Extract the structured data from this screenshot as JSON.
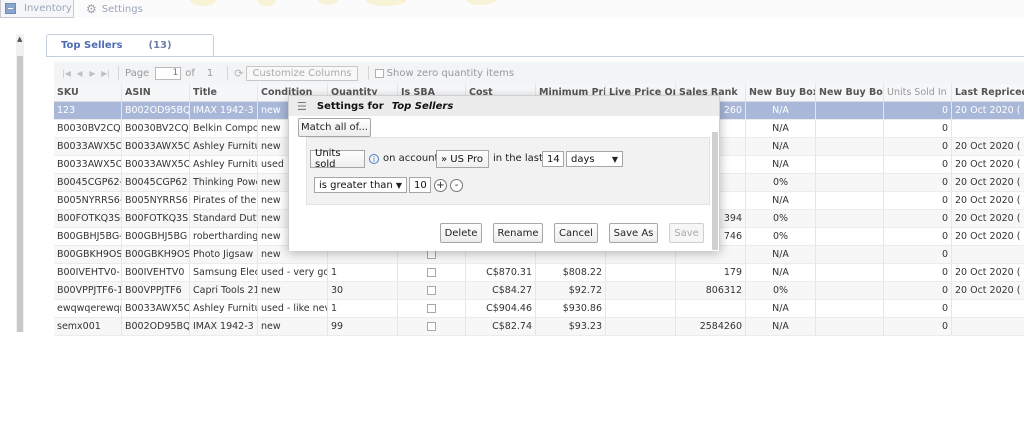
{
  "nav": {
    "inventory": "Inventory",
    "settings": "Settings"
  },
  "tab": {
    "label": "Top Sellers",
    "count": "(13)"
  },
  "pager": {
    "page_label": "Page",
    "page_value": "1",
    "of_label": "of",
    "total_pages": "1",
    "customize_label": "Customize Columns",
    "zero_qty_label": "Show zero quantity items"
  },
  "columns": [
    "SKU",
    "ASIN",
    "Title",
    "Condition",
    "Quantity",
    "Is SBA",
    "Cost",
    "Minimum Pri",
    "Live Price Or",
    "Sales Rank",
    "New Buy Box",
    "New Buy Box",
    "Units Sold In",
    "Last Repriced"
  ],
  "rows": [
    [
      "123",
      "B002OD95BQ",
      "IMAX 1942-3",
      "new",
      "",
      "",
      "",
      "",
      "",
      "260",
      "N/A",
      "",
      "0",
      "20 Oct 2020 ("
    ],
    [
      "B0030BV2CQ-",
      "B0030BV2CQ",
      "Belkin Compo",
      "new",
      "",
      "",
      "",
      "",
      "",
      "",
      "N/A",
      "",
      "0",
      ""
    ],
    [
      "B0033AWX5O",
      "B0033AWX5O",
      "Ashley Furnitu",
      "new",
      "",
      "",
      "",
      "",
      "",
      "",
      "N/A",
      "",
      "0",
      "20 Oct 2020 ("
    ],
    [
      "B0033AWX5O",
      "B0033AWX5O",
      "Ashley Furnitu",
      "used",
      "",
      "",
      "",
      "",
      "",
      "",
      "N/A",
      "",
      "0",
      "20 Oct 2020 ("
    ],
    [
      "B0045CGP62-",
      "B0045CGP62",
      "Thinking Powe",
      "new",
      "",
      "",
      "",
      "",
      "",
      "",
      "0%",
      "",
      "0",
      "20 Oct 2020 ("
    ],
    [
      "B005NYRRS6-",
      "B005NYRRS6",
      "Pirates of the",
      "new",
      "",
      "",
      "",
      "",
      "",
      "",
      "N/A",
      "",
      "0",
      "20 Oct 2020 ("
    ],
    [
      "B00FOTKQ3S-",
      "B00FOTKQ3S",
      "Standard Duty",
      "new",
      "",
      "",
      "",
      "",
      "",
      "394",
      "0%",
      "",
      "0",
      "20 Oct 2020 ("
    ],
    [
      "B00GBHJ5BG-",
      "B00GBHJ5BG",
      "robertharding",
      "new",
      "",
      "",
      "",
      "",
      "",
      "746",
      "0%",
      "",
      "0",
      "20 Oct 2020 ("
    ],
    [
      "B00GBKH9OS",
      "B00GBKH9OS",
      "Photo Jigsaw F",
      "new",
      "",
      "",
      "",
      "",
      "",
      "",
      "N/A",
      "",
      "0",
      ""
    ],
    [
      "B00IVEHTV0-",
      "B00IVEHTV0",
      "Samsung Elec",
      "used - very go",
      "1",
      "",
      "C$870.31",
      "$808.22",
      "",
      "179",
      "N/A",
      "",
      "0",
      "20 Oct 2020 ("
    ],
    [
      "B00VPPJTF6-1",
      "B00VPPJTF6",
      "Capri Tools 21",
      "new",
      "30",
      "",
      "C$84.27",
      "$92.72",
      "",
      "806312",
      "0%",
      "",
      "0",
      "20 Oct 2020 ("
    ],
    [
      "ewqwqerewqr",
      "B0033AWX5O",
      "Ashley Furnitu",
      "used - like nev",
      "1",
      "",
      "C$904.46",
      "$930.86",
      "",
      "",
      "N/A",
      "",
      "0",
      ""
    ],
    [
      "semx001",
      "B002OD95BQ",
      "IMAX 1942-3",
      "new",
      "99",
      "",
      "C$82.74",
      "$93.23",
      "",
      "2584260",
      "N/A",
      "",
      "0",
      ""
    ]
  ],
  "dialog": {
    "title_prefix": "Settings for",
    "title_name": "Top Sellers",
    "match_label": "Match all of...",
    "metric": "Units sold",
    "on_account": "on account",
    "account": "» US Pro",
    "in_the_last": "in the last",
    "period_value": "14",
    "period_unit": "days",
    "operator": "is greater than",
    "threshold": "10",
    "plus": "+",
    "minus": "-",
    "buttons": {
      "delete": "Delete",
      "rename": "Rename",
      "cancel": "Cancel",
      "save_as": "Save As",
      "save": "Save"
    }
  },
  "colors": {
    "accent": "#4d6bb5",
    "selected_row": "#a9b8d8",
    "dialog_bg": "#dfdfdf"
  }
}
